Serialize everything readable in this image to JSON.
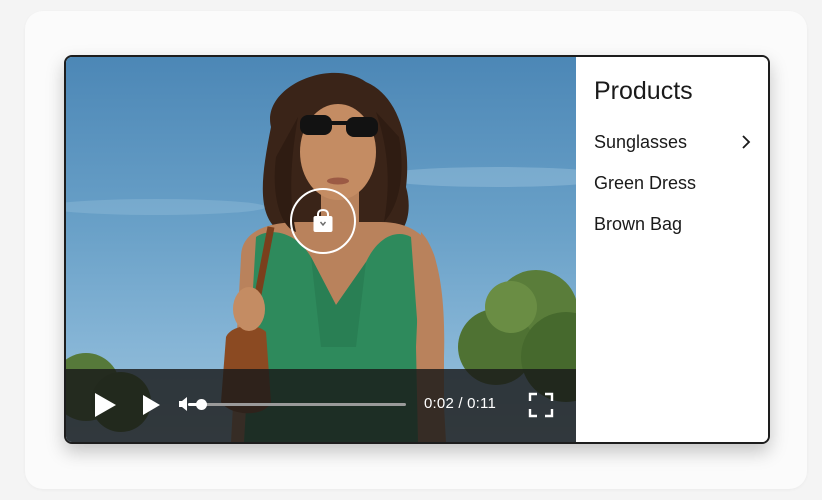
{
  "player": {
    "current_time": "0:02",
    "duration": "0:11",
    "time_separator": " / ",
    "progress_fraction": 0.06
  },
  "panel": {
    "title": "Products",
    "items": [
      {
        "label": "Sunglasses",
        "has_chevron": true
      },
      {
        "label": "Green Dress",
        "has_chevron": false
      },
      {
        "label": "Brown Bag",
        "has_chevron": false
      }
    ]
  },
  "icons": {
    "hotspot": "shopping-bag-icon",
    "play": "play-icon",
    "next": "next-icon",
    "volume": "volume-icon",
    "fullscreen": "fullscreen-icon",
    "chevron": "chevron-right-icon"
  },
  "colors": {
    "dress": "#2e8a5c",
    "sky": "#6aa1c8",
    "bag": "#8b4a22",
    "controls_bg": "#1a1a1a"
  }
}
